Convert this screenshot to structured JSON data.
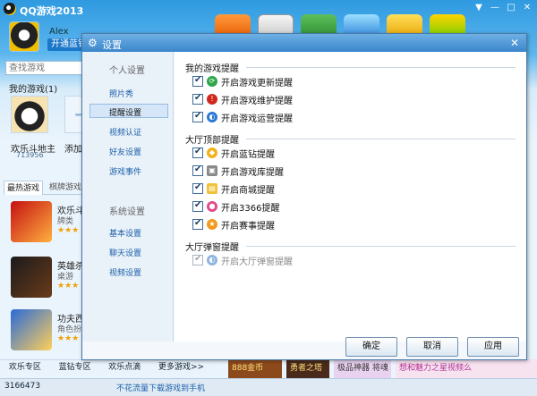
{
  "main": {
    "title": "QQ游戏2013",
    "window_controls": [
      "▼",
      "—",
      "□",
      "✕"
    ],
    "user": {
      "name": "Alex",
      "vip_button": "开通蓝钻"
    },
    "search": {
      "placeholder": "查找游戏"
    },
    "my_games": {
      "title": "我的游戏(1)",
      "tiles": [
        {
          "label": "欢乐斗地主",
          "count": "713956"
        },
        {
          "label": "添加"
        }
      ]
    },
    "tabs": [
      "最热游戏",
      "棋牌游戏"
    ],
    "games": [
      {
        "name": "欢乐斗",
        "category": "牌类",
        "stars": "★★★"
      },
      {
        "name": "英雄杀",
        "category": "桌游",
        "stars": "★★★"
      },
      {
        "name": "功夫西",
        "category": "角色扮",
        "stars": "★★★"
      }
    ],
    "bottom_links": [
      "欢乐专区",
      "蓝钻专区",
      "欢乐点滴",
      "更多游戏>>"
    ],
    "status": {
      "online_count": "3166473",
      "ad_text": "不花流量下载游戏到手机"
    },
    "banners": [
      "888金币",
      "勇者之塔",
      "极品神器 将魂",
      "想和魅力之星视频么"
    ]
  },
  "dialog": {
    "title": "设置",
    "close": "✕",
    "sidebar": {
      "section_personal": "个人设置",
      "personal_items": [
        "照片秀",
        "提醒设置",
        "视频认证",
        "好友设置",
        "游戏事件"
      ],
      "section_system": "系统设置",
      "system_items": [
        "基本设置",
        "聊天设置",
        "视频设置"
      ],
      "active_item": "提醒设置"
    },
    "groups": {
      "my_game_reminders": {
        "title": "我的游戏提醒",
        "options": [
          {
            "label": "开启游戏更新提醒",
            "checked": true,
            "icon": "update-icon"
          },
          {
            "label": "开启游戏维护提醒",
            "checked": true,
            "icon": "maintenance-icon"
          },
          {
            "label": "开启游戏运营提醒",
            "checked": true,
            "icon": "operation-icon"
          }
        ]
      },
      "lobby_top_reminders": {
        "title": "大厅顶部提醒",
        "options": [
          {
            "label": "开启蓝钻提醒",
            "checked": true,
            "icon": "diamond-icon"
          },
          {
            "label": "开启游戏库提醒",
            "checked": true,
            "icon": "game-library-icon"
          },
          {
            "label": "开启商城提醒",
            "checked": true,
            "icon": "mall-icon"
          },
          {
            "label": "开启3366提醒",
            "checked": true,
            "icon": "3366-icon"
          },
          {
            "label": "开启赛事提醒",
            "checked": true,
            "icon": "event-icon"
          }
        ]
      },
      "lobby_popup_reminders": {
        "title": "大厅弹窗提醒",
        "options": [
          {
            "label": "开启大厅弹窗提醒",
            "checked": true,
            "disabled": true,
            "icon": "popup-icon"
          }
        ]
      }
    },
    "buttons": {
      "ok": "确定",
      "cancel": "取消",
      "apply": "应用"
    }
  }
}
